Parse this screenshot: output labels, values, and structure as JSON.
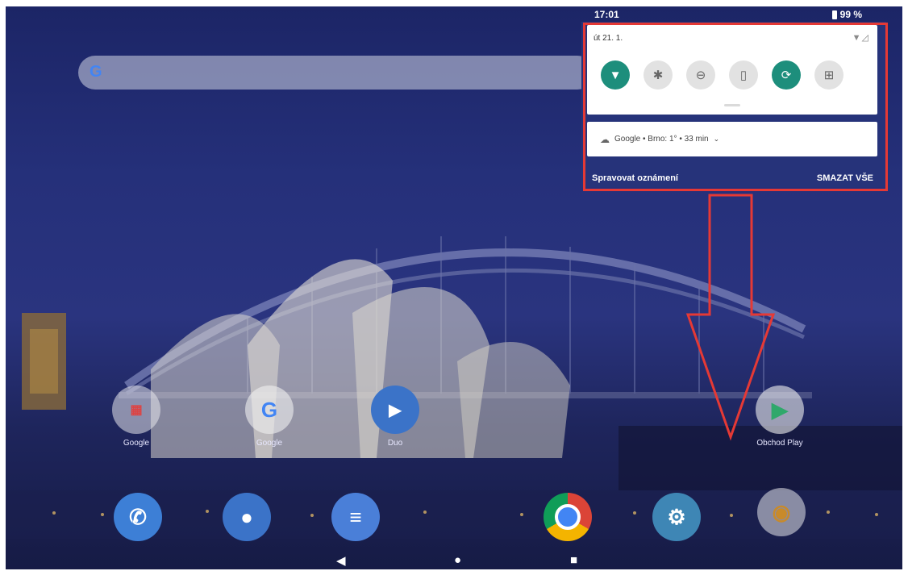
{
  "status_bar": {
    "time": "17:01",
    "battery": "99 %"
  },
  "search": {
    "logo_letter": "G"
  },
  "quick_settings": {
    "date": "út 21. 1.",
    "tiles": [
      {
        "icon": "wifi-icon",
        "state": "on"
      },
      {
        "icon": "bluetooth-icon",
        "state": "off"
      },
      {
        "icon": "do-not-disturb-icon",
        "state": "off"
      },
      {
        "icon": "flashlight-icon",
        "state": "off"
      },
      {
        "icon": "auto-rotate-icon",
        "state": "on"
      },
      {
        "icon": "battery-saver-icon",
        "state": "off"
      }
    ]
  },
  "notification": {
    "text": "Google • Brno: 1° • 33 min"
  },
  "shade_actions": {
    "manage": "Spravovat oznámení",
    "clear_all": "SMAZAT VŠE"
  },
  "home_apps": [
    {
      "label": "Google",
      "icon": "google-folder-icon"
    },
    {
      "label": "Google",
      "icon": "google-app-icon"
    },
    {
      "label": "Duo",
      "icon": "duo-icon"
    },
    {
      "label": "Obchod Play",
      "icon": "play-store-icon"
    }
  ],
  "dock_apps": [
    {
      "icon": "phone-icon"
    },
    {
      "icon": "contacts-icon"
    },
    {
      "icon": "messages-icon"
    },
    {
      "icon": "chrome-icon"
    },
    {
      "icon": "settings-icon"
    },
    {
      "icon": "camera-icon"
    }
  ],
  "colors": {
    "accent": "#1d8e7c",
    "annotation": "#e53935",
    "shade_bg": "#26337a"
  }
}
